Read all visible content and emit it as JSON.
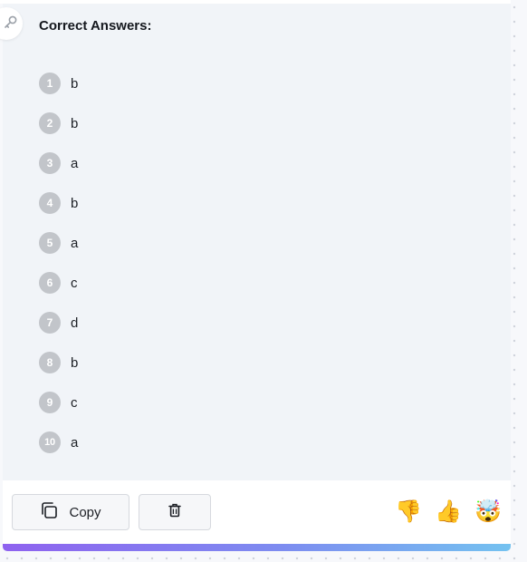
{
  "header": {
    "title": "Correct Answers:"
  },
  "answers": [
    {
      "number": "1",
      "answer": "b"
    },
    {
      "number": "2",
      "answer": "b"
    },
    {
      "number": "3",
      "answer": "a"
    },
    {
      "number": "4",
      "answer": "b"
    },
    {
      "number": "5",
      "answer": "a"
    },
    {
      "number": "6",
      "answer": "c"
    },
    {
      "number": "7",
      "answer": "d"
    },
    {
      "number": "8",
      "answer": "b"
    },
    {
      "number": "9",
      "answer": "c"
    },
    {
      "number": "10",
      "answer": "a"
    }
  ],
  "footer": {
    "copy_label": "Copy",
    "delete_icon": "trash-icon",
    "reactions": [
      {
        "icon": "thumbs-down-icon",
        "glyph": "👎"
      },
      {
        "icon": "thumbs-up-icon",
        "glyph": "👍"
      },
      {
        "icon": "mind-blown-icon",
        "glyph": "🤯"
      }
    ]
  },
  "colors": {
    "card_bg": "#f1f4f8",
    "number_badge": "#c2c5ca",
    "gradient_start": "#8e62ef",
    "gradient_end": "#74c2f0"
  }
}
